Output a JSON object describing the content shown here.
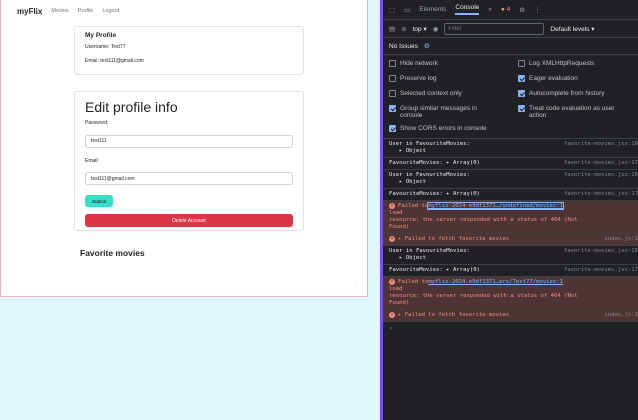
{
  "app": {
    "brand": "myFlix",
    "nav": [
      "Movies",
      "Profile",
      "Logout"
    ],
    "profile": {
      "title": "My Profile",
      "username": "Username: Test77",
      "email": "Email: test111@gmail.com"
    },
    "edit": {
      "title": "Edit profile info",
      "password_label": "Password:",
      "password_value": "test111",
      "email_label": "Email:",
      "email_value": "test111@gmail.com",
      "submit_label": "Submit",
      "delete_label": "Delete Account"
    },
    "favorites_title": "Favorite movies"
  },
  "devtools": {
    "tabs": [
      "Elements",
      "Console"
    ],
    "error_count": "4",
    "context": "top ▾",
    "filter_placeholder": "Filter",
    "levels": "Default levels ▾",
    "issues": "No Issues",
    "settings": [
      {
        "label": "Hide network",
        "checked": false
      },
      {
        "label": "Log XMLHttpRequests",
        "checked": false
      },
      {
        "label": "Preserve log",
        "checked": false
      },
      {
        "label": "Eager evaluation",
        "checked": true
      },
      {
        "label": "Selected context only",
        "checked": false
      },
      {
        "label": "Autocomplete from history",
        "checked": true
      },
      {
        "label": "Group similar messages in console",
        "checked": true
      },
      {
        "label": "Treat code evaluation as user action",
        "checked": true
      },
      {
        "label": "Show CORS errors in console",
        "checked": true
      }
    ],
    "logs": [
      {
        "text": "User in FavouriteMovies:",
        "sub": "▸ Object",
        "src": "favorite-movies.jsx:16"
      },
      {
        "text": "FavouriteMovies:  ▸ Array(0)",
        "src": "favorite-movies.jsx:17"
      },
      {
        "text": "User in FavouriteMovies:",
        "sub": "▸ Object",
        "src": "favorite-movies.jsx:16"
      },
      {
        "text": "FavouriteMovies:  ▸ Array(0)",
        "src": "favorite-movies.jsx:17"
      },
      {
        "error": true,
        "pre": "Failed to ",
        "link": "myflix-2024-e9df1371…/undefined/movies:1",
        "rest": "load",
        "line2": "resource: the server responded with a status of 404 (Not",
        "line3": "Found)"
      },
      {
        "error": true,
        "text": "▸ Failed to fetch favorite movies",
        "src": "index.js:1"
      },
      {
        "text": "User in FavouriteMovies:",
        "sub": "▸ Object",
        "src": "favorite-movies.jsx:16"
      },
      {
        "text": "FavouriteMovies:  ▸ Array(0)",
        "src": "favorite-movies.jsx:17"
      },
      {
        "error": true,
        "pre": "Failed to ",
        "link": "myflix-2024-e9df1371…ers/Test77/movies:1",
        "rest": "load",
        "line2": "resource: the server responded with a status of 404 (Not",
        "line3": "Found)"
      },
      {
        "error": true,
        "text": "▸ Failed to fetch favorite movies",
        "src": "index.js:1"
      }
    ]
  },
  "colors": {
    "background": "#7b4fe0",
    "submit": "#36e0c8",
    "delete": "#dc3545",
    "devtools_bg": "#202124",
    "error_bg": "#4e3534"
  }
}
